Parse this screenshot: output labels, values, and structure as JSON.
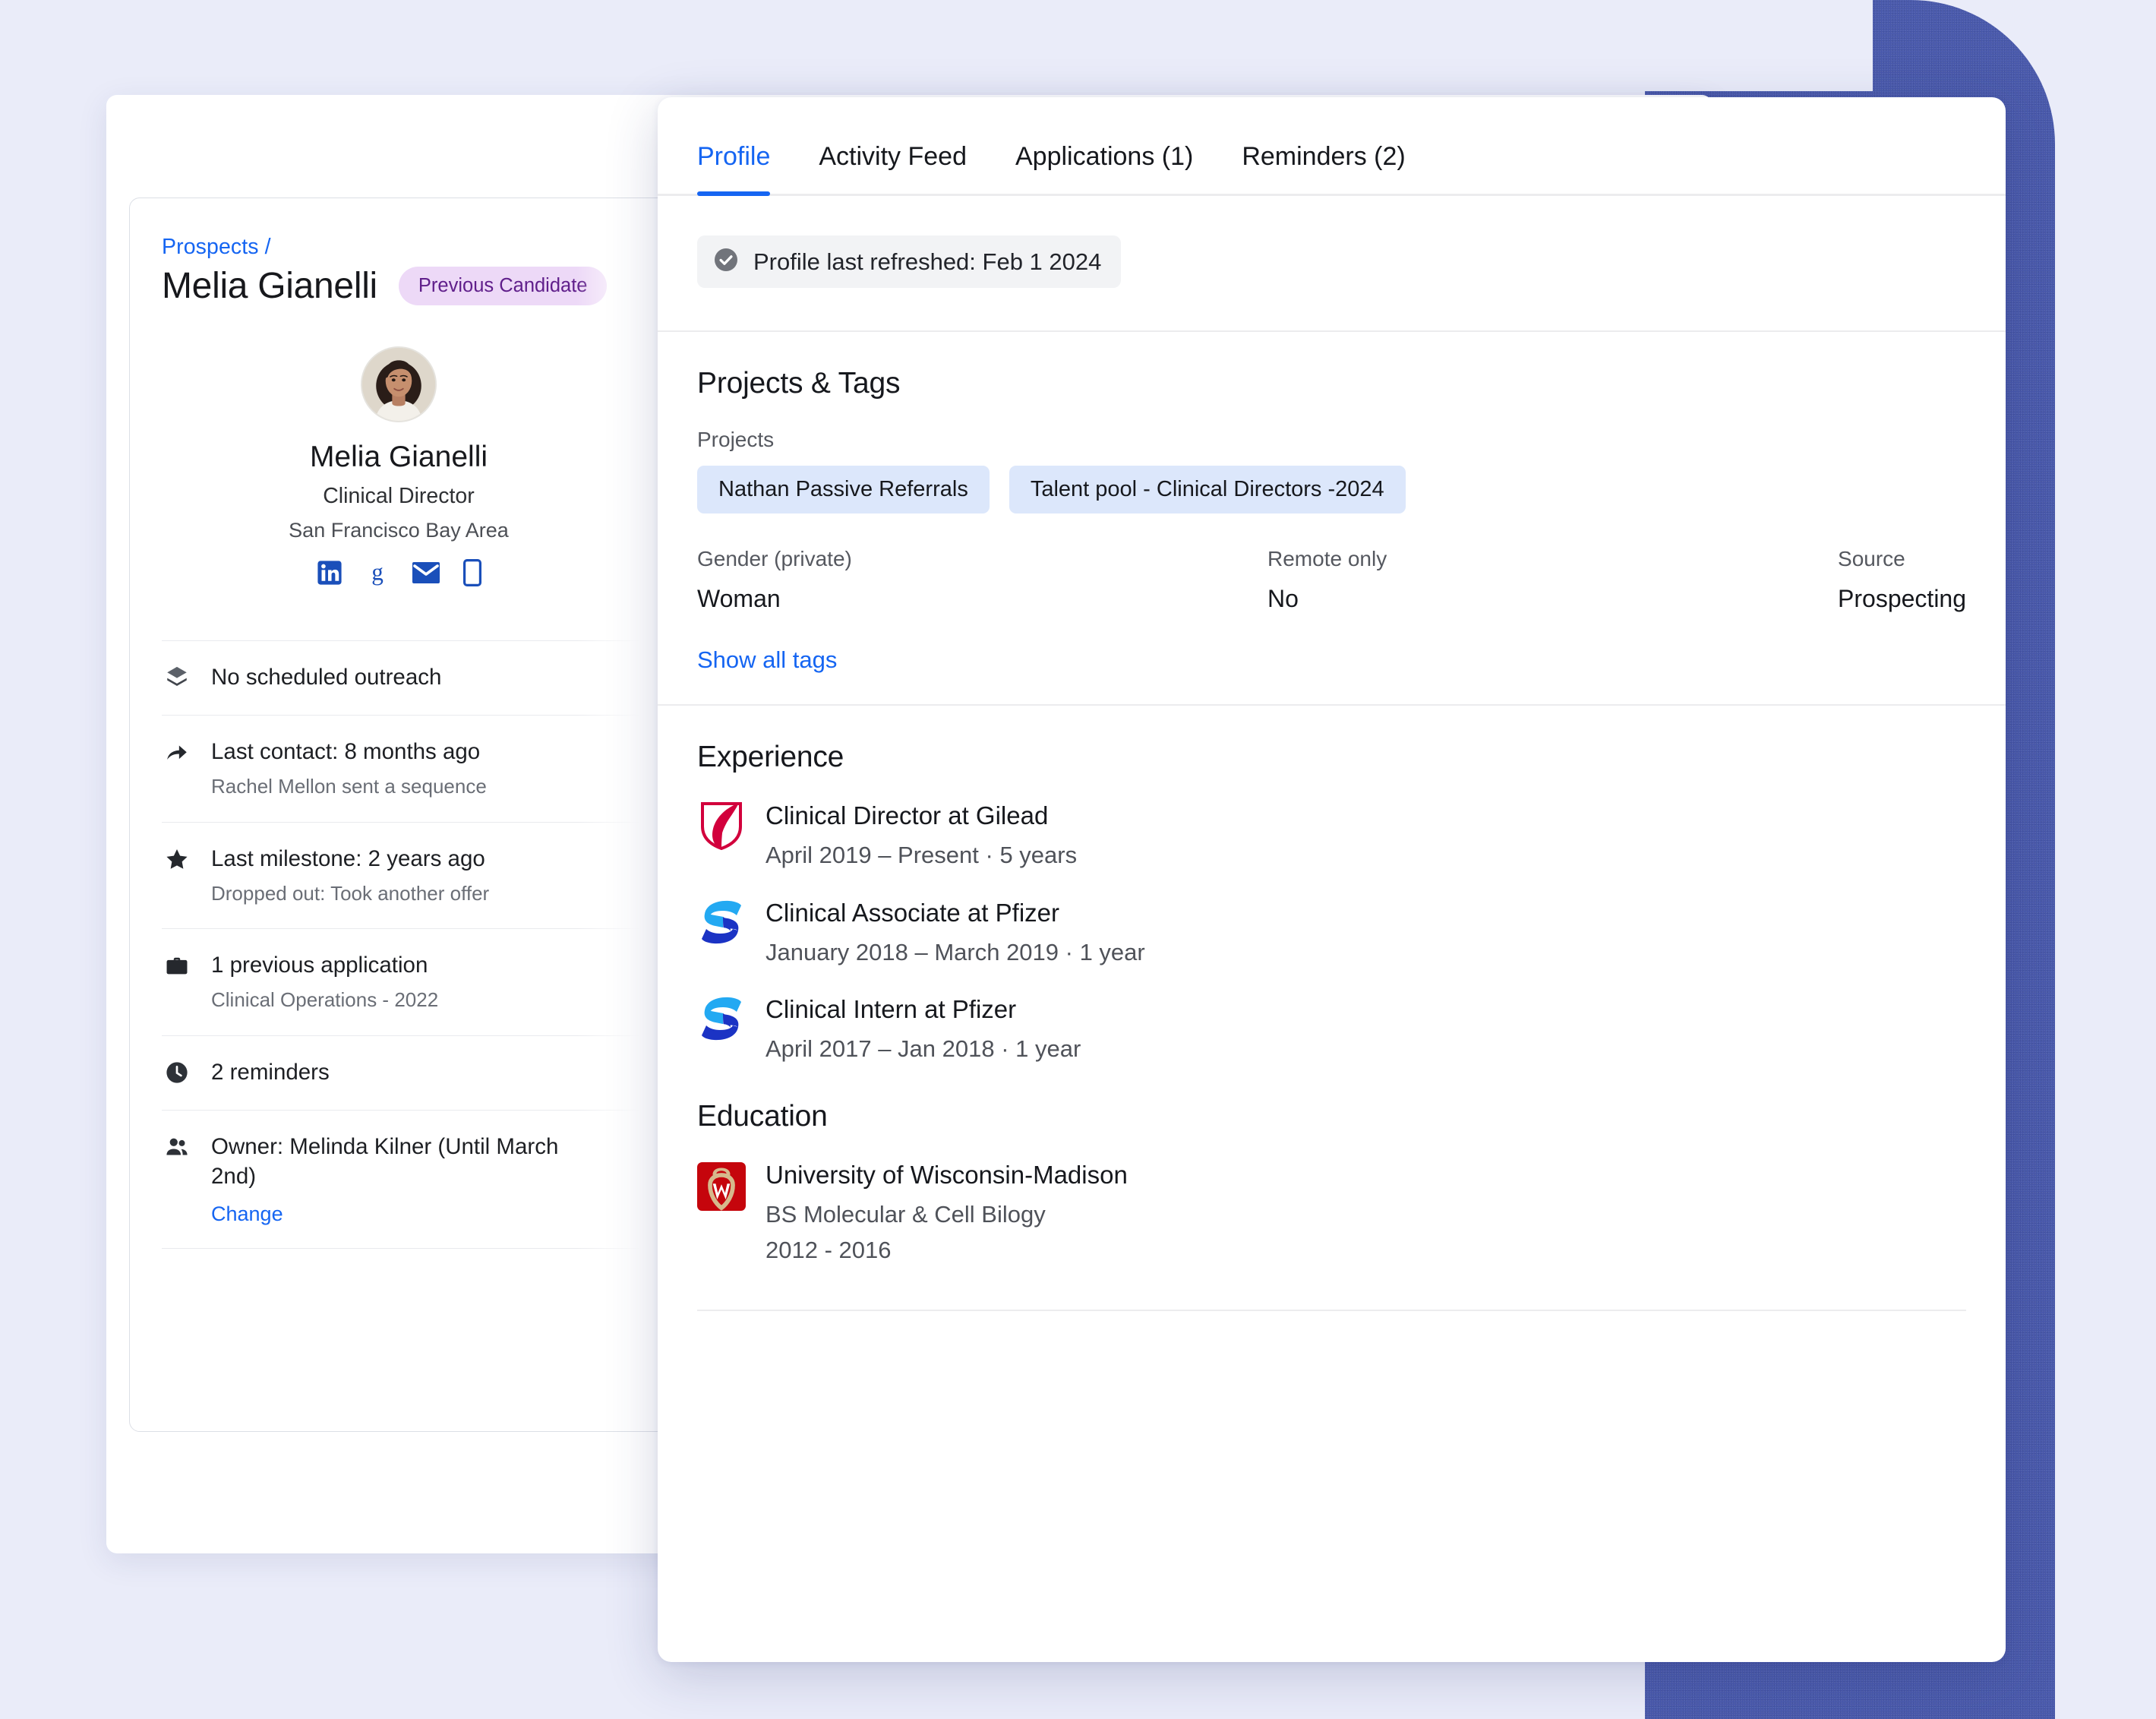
{
  "background": {
    "page_color": "#eaecf9",
    "accent_color": "#4858ab",
    "link_color": "#1565f2"
  },
  "profile_card": {
    "breadcrumb": "Prospects /",
    "name": "Melia Gianelli",
    "status_badge": "Previous Candidate",
    "avatar_name": "Melia Gianelli",
    "role": "Clinical Director",
    "location": "San Francisco Bay Area",
    "social": [
      {
        "name": "linkedin-icon",
        "label": "LinkedIn"
      },
      {
        "name": "google-icon",
        "label": "Google"
      },
      {
        "name": "email-icon",
        "label": "Email"
      },
      {
        "name": "phone-icon",
        "label": "Phone"
      }
    ],
    "info_rows": [
      {
        "icon": "layers-icon",
        "primary": "No scheduled outreach",
        "secondary": "",
        "link": ""
      },
      {
        "icon": "share-arrow-icon",
        "primary": "Last contact: 8 months ago",
        "secondary": "Rachel Mellon sent a sequence",
        "link": ""
      },
      {
        "icon": "star-icon",
        "primary": "Last milestone: 2 years ago",
        "secondary": "Dropped out: Took another offer",
        "link": ""
      },
      {
        "icon": "briefcase-icon",
        "primary": "1 previous application",
        "secondary": "Clinical Operations - 2022",
        "link": ""
      },
      {
        "icon": "clock-icon",
        "primary": "2 reminders",
        "secondary": "",
        "link": ""
      },
      {
        "icon": "people-icon",
        "primary": "Owner: Melinda Kilner (Until March 2nd)",
        "secondary": "",
        "link": "Change"
      }
    ]
  },
  "detail_panel": {
    "tabs": [
      {
        "label": "Profile",
        "active": true
      },
      {
        "label": "Activity Feed",
        "active": false
      },
      {
        "label": "Applications (1)",
        "active": false
      },
      {
        "label": "Reminders (2)",
        "active": false
      }
    ],
    "refresh_badge": "Profile last refreshed: Feb 1 2024",
    "projects_tags": {
      "title": "Projects & Tags",
      "projects_label": "Projects",
      "projects": [
        "Nathan Passive Referrals",
        "Talent pool - Clinical Directors -2024"
      ],
      "meta": [
        {
          "key": "Gender (private)",
          "value": "Woman"
        },
        {
          "key": "Remote only",
          "value": "No"
        },
        {
          "key": "Source",
          "value": "Prospecting"
        }
      ],
      "show_all_tags": "Show all tags"
    },
    "experience": {
      "title": "Experience",
      "entries": [
        {
          "logo": "gilead-logo",
          "title": "Clinical Director at Gilead",
          "dates": "April 2019 – Present  · 5 years"
        },
        {
          "logo": "pfizer-logo",
          "title": "Clinical Associate at Pfizer",
          "dates": "January 2018 – March 2019  · 1 year"
        },
        {
          "logo": "pfizer-logo",
          "title": "Clinical Intern at Pfizer",
          "dates": "April 2017 – Jan 2018  · 1 year"
        }
      ]
    },
    "education": {
      "title": "Education",
      "entries": [
        {
          "logo": "uw-madison-logo",
          "school": "University of Wisconsin-Madison",
          "degree": "BS Molecular & Cell Bilogy",
          "years": "2012 - 2016"
        }
      ]
    }
  }
}
